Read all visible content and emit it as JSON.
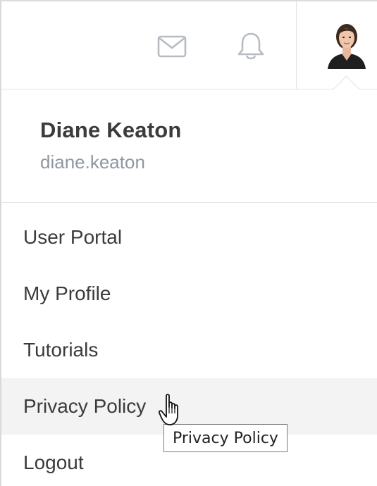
{
  "header": {
    "icons": [
      "mail-icon",
      "bell-icon"
    ],
    "avatar": "user-avatar"
  },
  "user": {
    "name": "Diane Keaton",
    "handle": "diane.keaton"
  },
  "menu": {
    "items": [
      {
        "label": "User Portal"
      },
      {
        "label": "My Profile"
      },
      {
        "label": "Tutorials"
      },
      {
        "label": "Privacy Policy",
        "hovered": true
      },
      {
        "label": "Logout"
      }
    ]
  },
  "tooltip": {
    "text": "Privacy Policy"
  },
  "colors": {
    "text": "#3b3b3b",
    "muted": "#8f97a3",
    "hover_bg": "#f3f3f3",
    "icon": "#b7bcc4"
  }
}
